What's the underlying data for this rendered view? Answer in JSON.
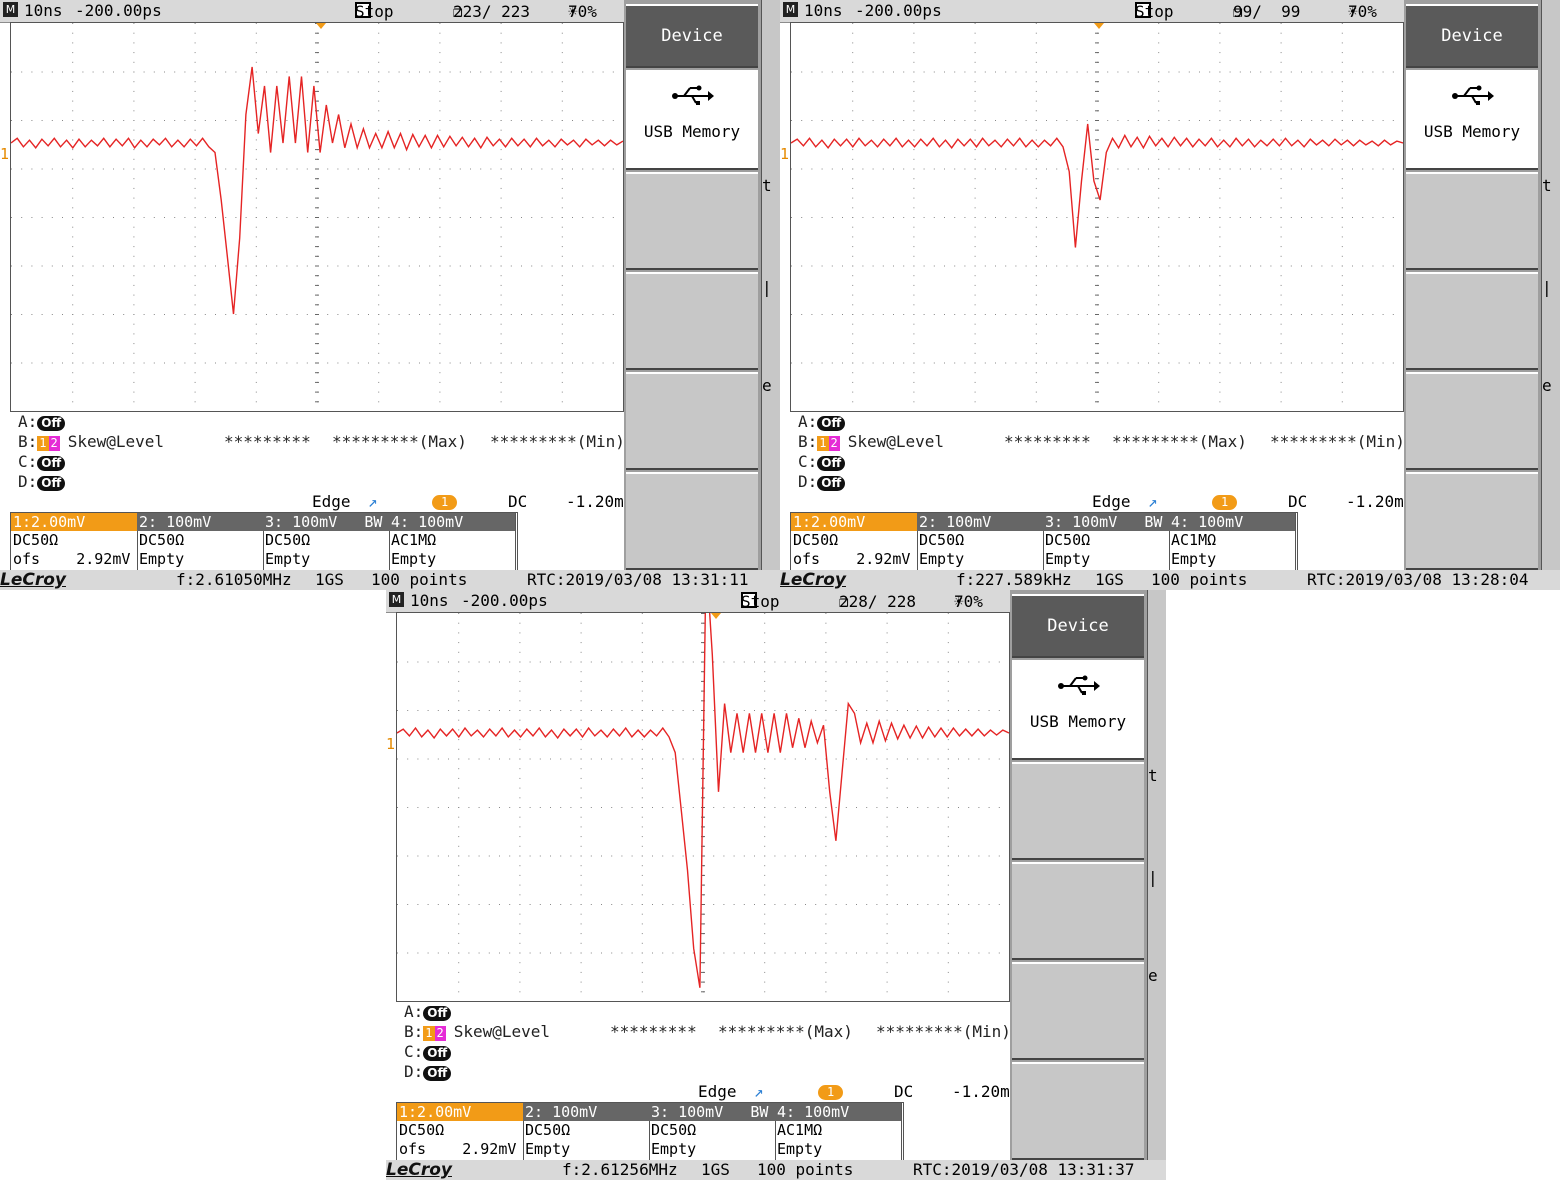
{
  "colors": {
    "trace": "#e52424",
    "ch1": "#f29b17",
    "ch2": "#e52bd6",
    "menu_title": "#5a5a5a"
  },
  "scopes": [
    {
      "timebase": "10ns",
      "delay": "-200.00ps",
      "run_state": "Stop",
      "count": "223/ 223",
      "brightness": "70%",
      "menu": {
        "title": "Device",
        "selected": "USB Memory",
        "icon": "usb-icon"
      },
      "side_letters": [
        "t",
        "|",
        "e"
      ],
      "level_marker": "1",
      "measure": {
        "rows": [
          {
            "slot": "A:",
            "state": "Off"
          },
          {
            "slot": "B:",
            "sources": [
              "1",
              "2"
            ],
            "param": "Skew@Level",
            "value": "*********",
            "max": "*********(Max)",
            "min": "*********(Min)"
          },
          {
            "slot": "C:",
            "state": "Off"
          },
          {
            "slot": "D:",
            "state": "Off"
          }
        ]
      },
      "trigger": {
        "type": "Edge",
        "source": "1",
        "coupling": "DC",
        "level": "-1.20m"
      },
      "channels": [
        {
          "label": "1:2.00mV",
          "line1": "DC50Ω",
          "line2": "ofs    2.92mV"
        },
        {
          "label": "2: 100mV",
          "line1": "DC50Ω",
          "line2": "Empty"
        },
        {
          "label": "3: 100mV   BW",
          "line1": "DC50Ω",
          "line2": "Empty"
        },
        {
          "label": "4: 100mV",
          "line1": "AC1MΩ",
          "line2": "Empty"
        }
      ],
      "status": {
        "brand": "LeCroy",
        "freq": "f:2.61050MHz",
        "rate": "1GS",
        "points": "100 points",
        "rtc": "RTC:2019/03/08 13:31:11"
      },
      "waveform": {
        "y": [
          0,
          0.5,
          -0.4,
          0.3,
          -0.5,
          0.4,
          -0.3,
          0.5,
          -0.4,
          0.3,
          -0.5,
          0.4,
          -0.4,
          0.3,
          -0.3,
          0.5,
          -0.4,
          0.4,
          -0.3,
          0.5,
          -0.5,
          0.3,
          -0.4,
          0.4,
          -0.2,
          0.5,
          -0.4,
          0.3,
          -0.4,
          0.4,
          -0.3,
          0.5,
          -0.4,
          -1,
          -6,
          -12,
          -18,
          -10,
          3,
          8,
          1,
          6,
          -1,
          6,
          0,
          7,
          0,
          7,
          -1,
          6,
          -1,
          4,
          0,
          3,
          -0.5,
          2,
          -0.5,
          1.5,
          -0.5,
          1,
          -0.5,
          1.2,
          -0.5,
          1,
          -0.7,
          0.9,
          -0.4,
          0.8,
          -0.5,
          0.8,
          -0.4,
          0.7,
          -0.3,
          0.6,
          -0.4,
          0.5,
          -0.5,
          0.6,
          -0.3,
          0.4,
          -0.4,
          0.5,
          -0.3,
          0.4,
          -0.4,
          0.5,
          -0.3,
          0.3,
          -0.4,
          0.4,
          -0.2,
          0.3,
          -0.4,
          0.4,
          -0.2,
          0.3,
          -0.3,
          0.3,
          -0.2,
          0.2
        ]
      }
    },
    {
      "timebase": "10ns",
      "delay": "-200.00ps",
      "run_state": "Stop",
      "count": "99/  99",
      "brightness": "70%",
      "menu": {
        "title": "Device",
        "selected": "USB Memory",
        "icon": "usb-icon"
      },
      "side_letters": [
        "t",
        "|",
        "e"
      ],
      "level_marker": "1",
      "measure": {
        "rows": [
          {
            "slot": "A:",
            "state": "Off"
          },
          {
            "slot": "B:",
            "sources": [
              "1",
              "2"
            ],
            "param": "Skew@Level",
            "value": "*********",
            "max": "*********(Max)",
            "min": "*********(Min)"
          },
          {
            "slot": "C:",
            "state": "Off"
          },
          {
            "slot": "D:",
            "state": "Off"
          }
        ]
      },
      "trigger": {
        "type": "Edge",
        "source": "1",
        "coupling": "DC",
        "level": "-1.20m"
      },
      "channels": [
        {
          "label": "1:2.00mV",
          "line1": "DC50Ω",
          "line2": "ofs    2.92mV"
        },
        {
          "label": "2: 100mV",
          "line1": "DC50Ω",
          "line2": "Empty"
        },
        {
          "label": "3: 100mV   BW",
          "line1": "DC50Ω",
          "line2": "Empty"
        },
        {
          "label": "4: 100mV",
          "line1": "AC1MΩ",
          "line2": "Empty"
        }
      ],
      "status": {
        "brand": "LeCroy",
        "freq": "f:227.589kHz",
        "rate": "1GS",
        "points": "100 points",
        "rtc": "RTC:2019/03/08 13:28:04"
      },
      "waveform": {
        "y": [
          0,
          0.4,
          -0.3,
          0.5,
          -0.4,
          0.3,
          -0.5,
          0.4,
          -0.3,
          0.4,
          -0.4,
          0.5,
          -0.3,
          0.3,
          -0.4,
          0.4,
          -0.3,
          0.5,
          -0.4,
          0.3,
          -0.4,
          0.4,
          -0.3,
          0.5,
          -0.4,
          0.3,
          -0.5,
          0.4,
          -0.3,
          0.4,
          -0.4,
          0.5,
          -0.3,
          0.3,
          -0.4,
          0.4,
          -0.3,
          0.5,
          -0.4,
          0.3,
          -0.4,
          0.3,
          -0.3,
          0.5,
          -0.4,
          -3,
          -11,
          -4,
          2,
          -4,
          -6,
          -1,
          0.5,
          -0.5,
          0.8,
          -0.4,
          0.6,
          -0.5,
          0.7,
          -0.3,
          0.5,
          -0.4,
          0.6,
          -0.3,
          0.5,
          -0.4,
          0.4,
          -0.3,
          0.5,
          -0.4,
          0.3,
          -0.4,
          0.5,
          -0.3,
          0.4,
          -0.4,
          0.3,
          -0.3,
          0.4,
          -0.3,
          0.5,
          -0.3,
          0.3,
          -0.4,
          0.4,
          -0.2,
          0.3,
          -0.3,
          0.4,
          -0.2,
          0.3,
          -0.3,
          0.3,
          -0.2,
          0.2,
          -0.3,
          0.3,
          -0.2,
          0.2,
          0
        ]
      }
    },
    {
      "timebase": "10ns",
      "delay": "-200.00ps",
      "run_state": "Stop",
      "count": "228/ 228",
      "brightness": "70%",
      "menu": {
        "title": "Device",
        "selected": "USB Memory",
        "icon": "usb-icon"
      },
      "side_letters": [
        "t",
        "|",
        "e"
      ],
      "level_marker": "1",
      "measure": {
        "rows": [
          {
            "slot": "A:",
            "state": "Off"
          },
          {
            "slot": "B:",
            "sources": [
              "1",
              "2"
            ],
            "param": "Skew@Level",
            "value": "*********",
            "max": "*********(Max)",
            "min": "*********(Min)"
          },
          {
            "slot": "C:",
            "state": "Off"
          },
          {
            "slot": "D:",
            "state": "Off"
          }
        ]
      },
      "trigger": {
        "type": "Edge",
        "source": "1",
        "coupling": "DC",
        "level": "-1.20m"
      },
      "channels": [
        {
          "label": "1:2.00mV",
          "line1": "DC50Ω",
          "line2": "ofs    2.92mV"
        },
        {
          "label": "2: 100mV",
          "line1": "DC50Ω",
          "line2": "Empty"
        },
        {
          "label": "3: 100mV   BW",
          "line1": "DC50Ω",
          "line2": "Empty"
        },
        {
          "label": "4: 100mV",
          "line1": "AC1MΩ",
          "line2": "Empty"
        }
      ],
      "status": {
        "brand": "LeCroy",
        "freq": "f:2.61256MHz",
        "rate": "1GS",
        "points": "100 points",
        "rtc": "RTC:2019/03/08 13:31:37"
      },
      "waveform": {
        "y": [
          0,
          0.4,
          -0.3,
          0.5,
          -0.4,
          0.3,
          -0.5,
          0.4,
          -0.3,
          0.4,
          -0.4,
          0.5,
          -0.3,
          0.3,
          -0.4,
          0.4,
          -0.3,
          0.5,
          -0.4,
          0.3,
          -0.4,
          0.4,
          -0.3,
          0.5,
          -0.4,
          0.3,
          -0.5,
          0.4,
          -0.3,
          0.4,
          -0.4,
          0.5,
          -0.3,
          0.3,
          -0.4,
          0.4,
          -0.3,
          0.5,
          -0.4,
          0.3,
          -0.4,
          0.3,
          -0.3,
          0.5,
          -0.4,
          -2,
          -8,
          -14,
          -22,
          -26,
          18,
          8,
          -6,
          3,
          -2,
          2,
          -2,
          2,
          -2,
          2,
          -2,
          2,
          -2,
          2,
          -1.5,
          1.5,
          -1.5,
          1.2,
          -1,
          0.8,
          -6,
          -11,
          -4,
          3,
          2,
          -1,
          1,
          -1,
          1.2,
          -0.8,
          1,
          -0.6,
          0.8,
          -0.5,
          0.7,
          -0.5,
          0.6,
          -0.4,
          0.5,
          -0.4,
          0.5,
          -0.3,
          0.4,
          -0.3,
          0.4,
          -0.3,
          0.3,
          -0.2,
          0.3,
          0
        ]
      }
    }
  ]
}
